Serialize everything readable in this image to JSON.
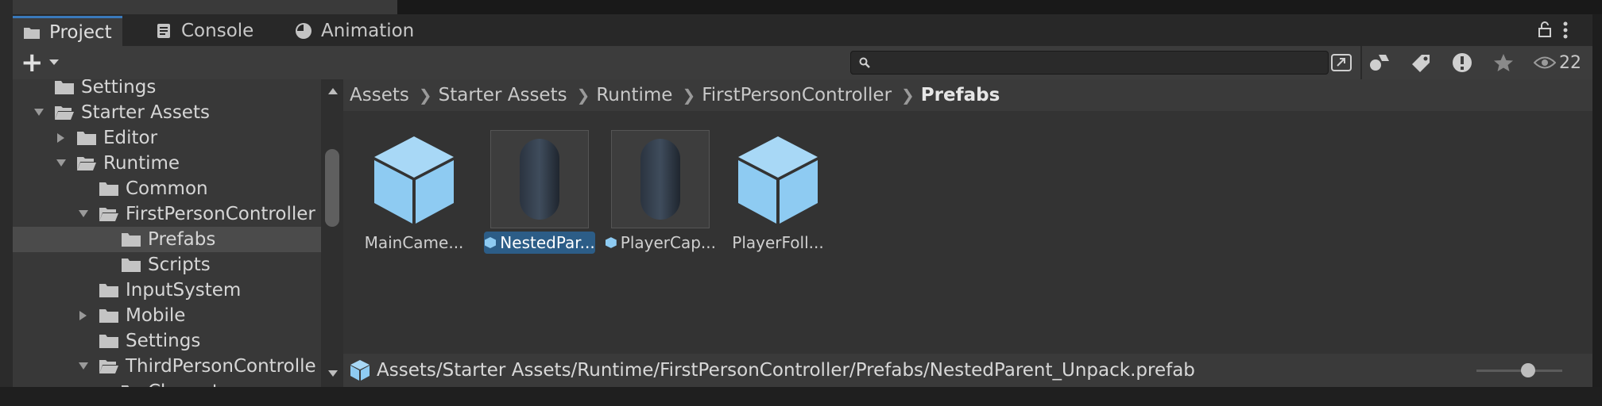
{
  "tabs": [
    {
      "label": "Project",
      "icon": "folder-icon",
      "active": true
    },
    {
      "label": "Console",
      "icon": "console-icon",
      "active": false
    },
    {
      "label": "Animation",
      "icon": "clock-icon",
      "active": false
    }
  ],
  "toolbar": {
    "add_label": "+",
    "search_placeholder": "",
    "hidden_count": "22"
  },
  "tree": {
    "items": [
      {
        "label": "Settings",
        "indent": 0,
        "expanded": null,
        "open": false
      },
      {
        "label": "Starter Assets",
        "indent": 0,
        "expanded": true,
        "open": true
      },
      {
        "label": "Editor",
        "indent": 1,
        "expanded": false,
        "open": false
      },
      {
        "label": "Runtime",
        "indent": 1,
        "expanded": true,
        "open": true
      },
      {
        "label": "Common",
        "indent": 2,
        "expanded": null,
        "open": false
      },
      {
        "label": "FirstPersonController",
        "indent": 2,
        "expanded": true,
        "open": true
      },
      {
        "label": "Prefabs",
        "indent": 3,
        "expanded": null,
        "open": false,
        "selected": true
      },
      {
        "label": "Scripts",
        "indent": 3,
        "expanded": null,
        "open": false
      },
      {
        "label": "InputSystem",
        "indent": 2,
        "expanded": null,
        "open": false
      },
      {
        "label": "Mobile",
        "indent": 2,
        "expanded": false,
        "open": false
      },
      {
        "label": "Settings",
        "indent": 2,
        "expanded": null,
        "open": false
      },
      {
        "label": "ThirdPersonControlle",
        "indent": 2,
        "expanded": true,
        "open": true
      },
      {
        "label": "Character",
        "indent": 3,
        "expanded": false,
        "open": false
      }
    ]
  },
  "breadcrumb": [
    "Assets",
    "Starter Assets",
    "Runtime",
    "FirstPersonController",
    "Prefabs"
  ],
  "assets": [
    {
      "name": "MainCame...",
      "kind": "cube",
      "selected": false,
      "badge": false
    },
    {
      "name": "NestedPar...",
      "kind": "capsule",
      "selected": true,
      "badge": true
    },
    {
      "name": "PlayerCap...",
      "kind": "capsule",
      "selected": false,
      "badge": true
    },
    {
      "name": "PlayerFoll...",
      "kind": "cube",
      "selected": false,
      "badge": false
    }
  ],
  "status": {
    "path": "Assets/Starter Assets/Runtime/FirstPersonController/Prefabs/NestedParent_Unpack.prefab",
    "zoom": 0.6
  },
  "colors": {
    "accent": "#3a79bb",
    "selection": "#2c5d87",
    "prefab_blue": "#8ecbf2"
  }
}
